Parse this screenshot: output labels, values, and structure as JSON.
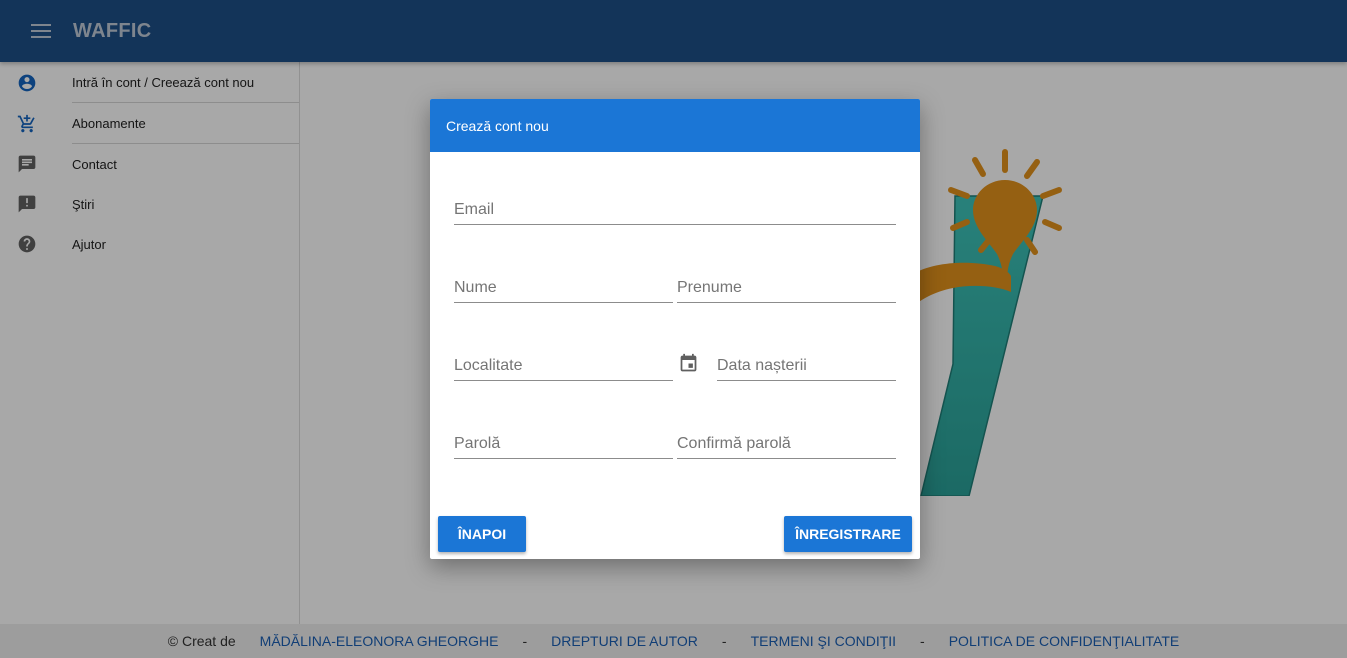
{
  "appbar": {
    "title": "WAFFIC",
    "menu_icon": "menu-icon"
  },
  "sidebar": {
    "items": [
      {
        "label": "Intră în cont / Creează cont nou",
        "icon": "account-circle-icon"
      },
      {
        "label": "Abonamente",
        "icon": "add-shopping-cart-icon"
      },
      {
        "label": "Contact",
        "icon": "chat-message-icon"
      },
      {
        "label": "Ştiri",
        "icon": "announcement-icon"
      },
      {
        "label": "Ajutor",
        "icon": "help-icon"
      }
    ]
  },
  "dialog": {
    "title": "Crează cont nou",
    "fields": {
      "email": {
        "placeholder": "Email",
        "value": ""
      },
      "nume": {
        "placeholder": "Nume",
        "value": ""
      },
      "prenume": {
        "placeholder": "Prenume",
        "value": ""
      },
      "localitate": {
        "placeholder": "Localitate",
        "value": ""
      },
      "data_nasterii": {
        "placeholder": "Data nașterii",
        "value": ""
      },
      "parola": {
        "placeholder": "Parolă",
        "value": ""
      },
      "confirma_parola": {
        "placeholder": "Confirmă parolă",
        "value": ""
      }
    },
    "back_label": "Înapoi",
    "register_label": "Înregistrare"
  },
  "footer": {
    "credit": "© Creat de",
    "author": "Mădălina-Eleonora Gheorghe",
    "sep": "-",
    "copyright": "Drepturi de autor",
    "terms": "Termeni şi condiţii",
    "privacy": "Politica de confidenţialitate"
  },
  "colors": {
    "appbar": "#1e4f88",
    "dialog_header": "#1b76d6",
    "button": "#1b76d6",
    "link": "#1a5fb4",
    "logo_teal": "#37b7ae",
    "logo_gold": "#e8961e"
  }
}
